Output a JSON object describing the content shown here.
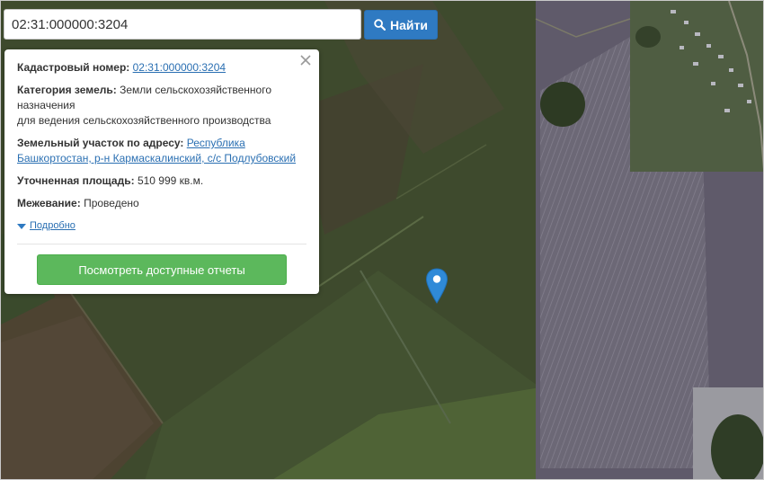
{
  "search": {
    "value": "02:31:000000:3204",
    "button_label": "Найти"
  },
  "popup": {
    "cadastral": {
      "label": "Кадастровый номер:",
      "value": "02:31:000000:3204"
    },
    "category": {
      "label": "Категория земель:",
      "value_line1": "Земли сельскохозяйственного назначения",
      "value_line2": "для ведения сельскохозяйственного производства"
    },
    "address": {
      "label": "Земельный участок по адресу:",
      "value": "Республика Башкортостан, р-н Кармаскалинский, с/с Подлубовский"
    },
    "area": {
      "label": "Уточненная площадь:",
      "value": "510 999 кв.м."
    },
    "survey": {
      "label": "Межевание:",
      "value": "Проведено"
    },
    "details_link": "Подробно",
    "reports_button": "Посмотреть доступные отчеты"
  },
  "colors": {
    "search_button": "#2f7ac2",
    "reports_button": "#5cb85c",
    "link": "#2a6fb2",
    "marker": "#2f8ad8"
  },
  "icons": {
    "search": "magnifier-icon",
    "close": "close-icon",
    "marker": "map-pin-icon",
    "details": "triangle-down-icon"
  }
}
